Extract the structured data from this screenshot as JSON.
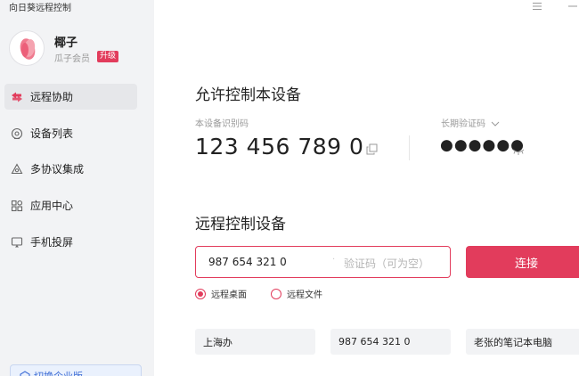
{
  "app": {
    "title": "向日葵远程控制"
  },
  "user": {
    "name": "椰子",
    "member": "瓜子会员",
    "upgrade": "升级"
  },
  "nav": [
    {
      "label": "远程协助",
      "icon": "remote-assist-icon",
      "active": true
    },
    {
      "label": "设备列表",
      "icon": "device-list-icon",
      "active": false
    },
    {
      "label": "多协议集成",
      "icon": "multi-protocol-icon",
      "active": false
    },
    {
      "label": "应用中心",
      "icon": "app-center-icon",
      "active": false
    },
    {
      "label": "手机投屏",
      "icon": "screen-cast-icon",
      "active": false
    }
  ],
  "enterprise": {
    "label": "切换企业版"
  },
  "allow": {
    "title": "允许控制本设备",
    "id_label": "本设备识别码",
    "id_value": "123 456 789 0",
    "code_label": "长期验证码",
    "code_value": "●●●●●●"
  },
  "remote": {
    "title": "远程控制设备",
    "id_value": "987 654 321 0",
    "code_placeholder": "验证码（可为空）",
    "connect_label": "连接",
    "options": [
      {
        "label": "远程桌面",
        "selected": true
      },
      {
        "label": "远程文件",
        "selected": false
      }
    ]
  },
  "recent": [
    {
      "label": "上海办"
    },
    {
      "label": "987 654 321 0"
    },
    {
      "label": "老张的笔记本电脑"
    }
  ],
  "colors": {
    "accent": "#e23c5c",
    "sidebar_bg": "#f2f3f5"
  }
}
